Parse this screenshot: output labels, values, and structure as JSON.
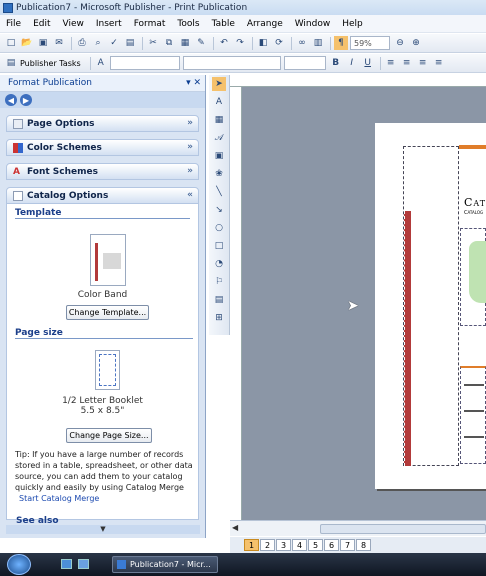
{
  "window": {
    "title": "Publication7 - Microsoft Publisher - Print Publication"
  },
  "menu": [
    "File",
    "Edit",
    "View",
    "Insert",
    "Format",
    "Tools",
    "Table",
    "Arrange",
    "Window",
    "Help"
  ],
  "toolbar": {
    "zoom": "59%",
    "publisher_tasks": "Publisher Tasks"
  },
  "taskpane": {
    "title": "Format Publication",
    "sections": [
      {
        "label": "Page Options"
      },
      {
        "label": "Color Schemes"
      },
      {
        "label": "Font Schemes"
      },
      {
        "label": "Catalog Options"
      }
    ],
    "template_heading": "Template",
    "template_name": "Color Band",
    "change_template": "Change Template...",
    "page_size_heading": "Page size",
    "page_size_name": "1/2 Letter Booklet",
    "page_size_dims": "5.5 x 8.5\"",
    "change_page_size": "Change Page Size...",
    "tip": "Tip: If you have a large number of records stored in a table, spreadsheet, or other data source, you can add them to your catalog quickly and easily by using Catalog Merge",
    "start_merge": "Start Catalog Merge",
    "see_also": "See also"
  },
  "page_nav": [
    "1",
    "2",
    "3",
    "4",
    "5",
    "6",
    "7",
    "8"
  ],
  "taskbar": {
    "app_label": "Publication7 - Micr..."
  },
  "document": {
    "title_fragment": "Cat",
    "subtitle_fragment": "Catalog"
  },
  "colors": {
    "accent": "#b23a3a",
    "workspace": "#8b96a6",
    "pane": "#d9e4f3"
  }
}
